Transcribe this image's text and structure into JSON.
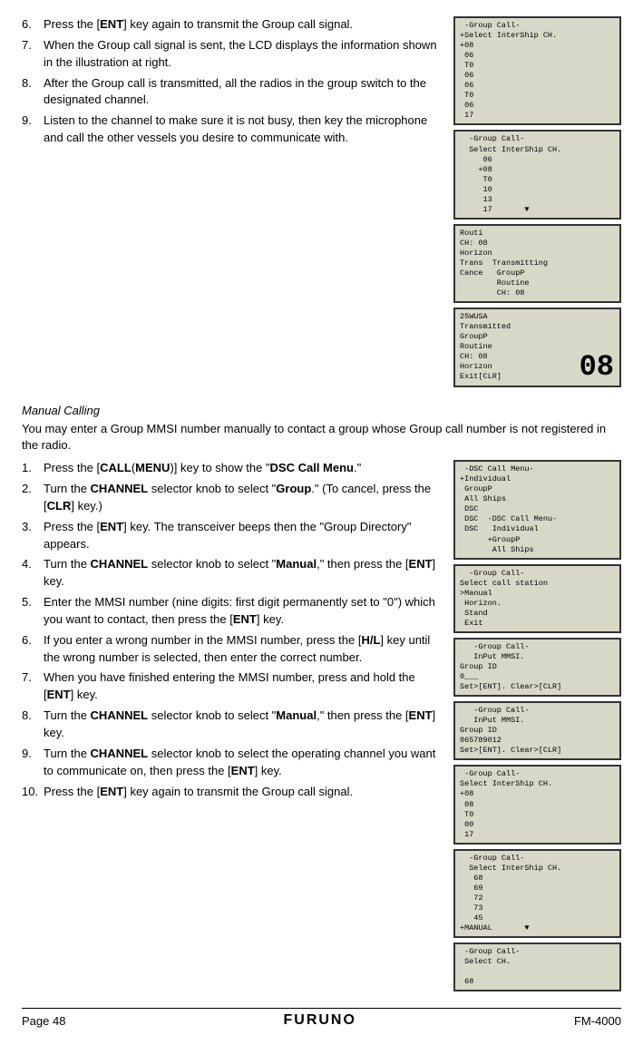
{
  "page": {
    "number": "Page 48",
    "model": "FM-4000",
    "logo": "FURUNO"
  },
  "top_section": {
    "items": [
      {
        "num": "6.",
        "text": "Press the [ENT] key again to transmit the Group call signal."
      },
      {
        "num": "7.",
        "text": "When the Group call signal is sent, the LCD displays the information shown in the illustration at right."
      },
      {
        "num": "8.",
        "text": "After the Group call is transmitted, all the radios in the group switch to the designated channel."
      },
      {
        "num": "9.",
        "text": "Listen to the channel to make sure it is not busy, then key the microphone and call the other vessels you desire to communicate with."
      }
    ],
    "screens": [
      {
        "id": "screen_top1",
        "content": " -Group Call-\n+Select InterShip CH.\n+08\n06\nT0\n06\n06\nT0\n06\n17"
      },
      {
        "id": "screen_top2",
        "content": "  -Group Call-\n  Select InterShip CH.\n  06\n  +08\n  T0\n  10\n  13\n  17       ▼"
      },
      {
        "id": "screen_top3",
        "content": "Routi\nCH: 08\nHorizon\nTrans Transmitting\nCance  GroupP\n  Routine\n  CH: 08"
      },
      {
        "id": "screen_top4",
        "content": "25WUSA\nTransmitted\nGroupP\nRoutine\nCH: 08\nHorizon\nExit[CLR]",
        "big_num": "08"
      }
    ]
  },
  "manual_calling_section": {
    "heading": "Manual Calling",
    "intro": "You may enter a Group MMSI number manually to contact a group whose Group call number is not registered in the radio.",
    "items": [
      {
        "num": "1.",
        "text": "Press the [CALL(MENU)] key to show the \"DSC Call Menu.\""
      },
      {
        "num": "2.",
        "text": "Turn the CHANNEL selector knob to select \"Group.\" (To cancel, press the [CLR] key.)"
      },
      {
        "num": "3.",
        "text": "Press the [ENT] key. The transceiver beeps then the \"Group Directory\" appears."
      },
      {
        "num": "4.",
        "text": "Turn the CHANNEL selector knob to select \"Manual,\" then press the [ENT] key."
      },
      {
        "num": "5.",
        "text": "Enter the MMSI number (nine digits: first digit permanently set to \"0\") which you want to contact, then press the [ENT] key."
      },
      {
        "num": "6.",
        "text": "If you enter a wrong number in the MMSI number, press the [H/L] key until the wrong number is selected, then enter the correct number."
      },
      {
        "num": "7.",
        "text": "When you have finished entering the MMSI number, press and hold the [ENT] key."
      },
      {
        "num": "8.",
        "text": "Turn the CHANNEL selector knob to select \"Manual,\" then press the [ENT] key."
      },
      {
        "num": "9.",
        "text": "Turn the CHANNEL selector knob to select the operating channel you want to communicate on, then press the [ENT] key."
      },
      {
        "num": "10.",
        "text": "Press the [ENT] key again to transmit the Group call signal."
      }
    ],
    "screens": [
      {
        "id": "screen_mc1",
        "content": " -DSC Call Menu-\n+Individual\n GroupP\n All Ships\n DSC  -DSC Call Menu-\n DSC   Individual\n DSC  +GroupP\n      All Ships\n"
      },
      {
        "id": "screen_mc2",
        "content": "  -Group Call-\nSelect call station\n>Manual\n Horizon.\n Stand\n Exit"
      },
      {
        "id": "screen_mc3",
        "content": "   -Group Call-\n   InPut MMSI.\nGroup ID\n0___\nSet>[ENT]. Clear>[CLR]"
      },
      {
        "id": "screen_mc4",
        "content": "   -Group Call-\n   InPut MMSI.\nGroup ID\n065789012\nSet>[ENT]. Clear>[CLR]"
      },
      {
        "id": "screen_mc5",
        "content": " -Group Call-\nSelect InterShip CH.\n+08\n08\nT0\n00\n17"
      },
      {
        "id": "screen_mc6",
        "content": "  -Group Call-\n  Select InterShip CH.\n  68\n  69\n  72\n  73\n  45\n+MANUAL       ▼"
      },
      {
        "id": "screen_mc7",
        "content": " -Group Call-\n Select CH.\n\n 68"
      }
    ]
  }
}
